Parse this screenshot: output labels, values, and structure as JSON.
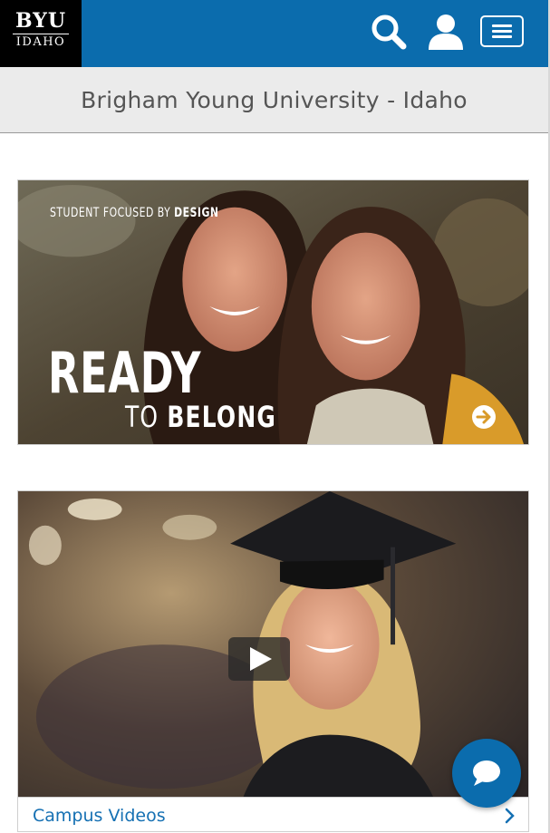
{
  "header": {
    "logo_line1": "BYU",
    "logo_line2": "IDAHO",
    "search_icon": "search-icon",
    "account_icon": "user-icon",
    "menu_icon": "hamburger-icon",
    "bar_color": "#0b6cad"
  },
  "title_bar": {
    "title": "Brigham Young University - Idaho"
  },
  "hero": {
    "tagline_regular_1": "STUDENT FOCUSED",
    "tagline_regular_2": " BY ",
    "tagline_bold": "DESIGN",
    "headline": "READY",
    "subhead_regular": "TO ",
    "subhead_bold": "BELONG",
    "arrow_icon": "arrow-right-circle-icon"
  },
  "video_card": {
    "play_icon": "play-icon",
    "caption": "Campus Videos",
    "chevron_icon": "chevron-right-icon"
  },
  "chat": {
    "icon": "chat-bubble-icon"
  }
}
